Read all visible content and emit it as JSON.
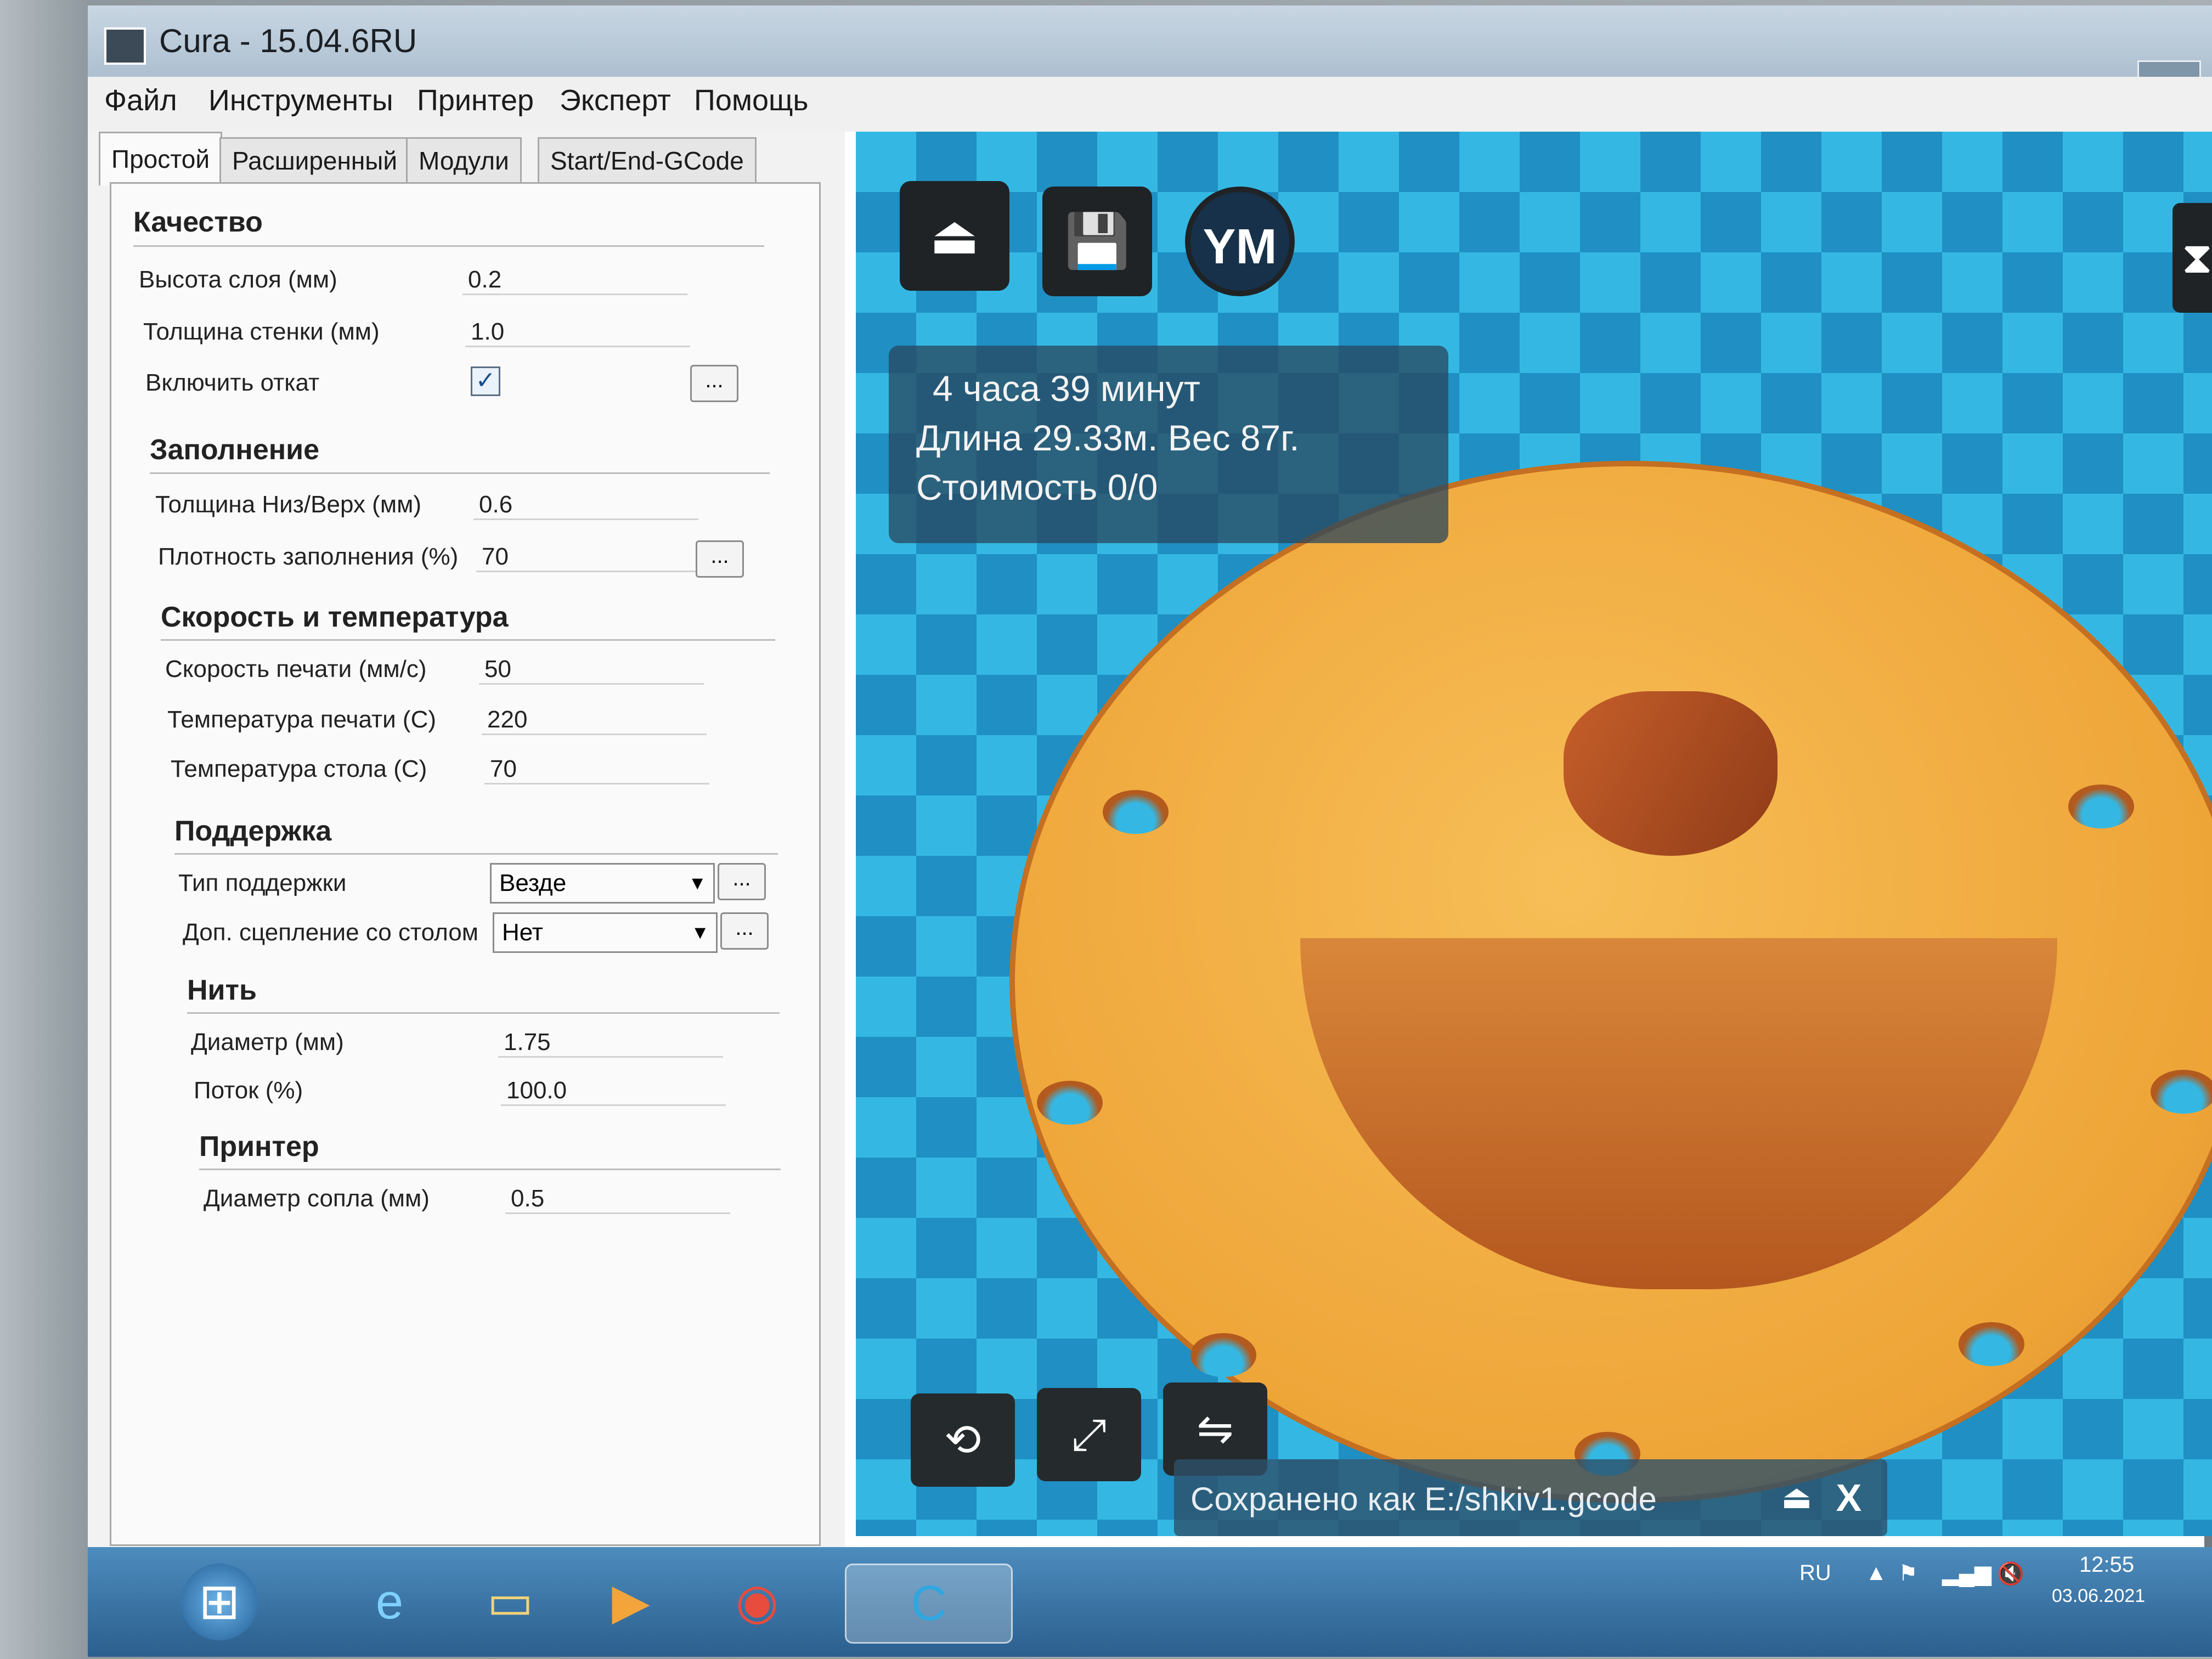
{
  "window": {
    "title": "Cura - 15.04.6RU"
  },
  "menu": [
    "Файл",
    "Инструменты",
    "Принтер",
    "Эксперт",
    "Помощь"
  ],
  "tabs": [
    {
      "label": "Простой",
      "active": true
    },
    {
      "label": "Расширенный"
    },
    {
      "label": "Модули"
    },
    {
      "label": "Start/End-GCode"
    }
  ],
  "settings": {
    "quality": {
      "title": "Качество",
      "layer_height_label": "Высота слоя (мм)",
      "layer_height": "0.2",
      "wall_thickness_label": "Толщина стенки (мм)",
      "wall_thickness": "1.0",
      "retraction_label": "Включить откат",
      "retraction_check": "✓",
      "more": "..."
    },
    "fill": {
      "title": "Заполнение",
      "bottom_top_label": "Толщина Низ/Верх (мм)",
      "bottom_top": "0.6",
      "density_label": "Плотность заполнения (%)",
      "density": "70",
      "more": "..."
    },
    "speed": {
      "title": "Скорость и температура",
      "print_speed_label": "Скорость печати (мм/с)",
      "print_speed": "50",
      "print_temp_label": "Температура печати (C)",
      "print_temp": "220",
      "bed_temp_label": "Температура стола (C)",
      "bed_temp": "70"
    },
    "support": {
      "title": "Поддержка",
      "type_label": "Тип поддержки",
      "type": "Везде",
      "adhesion_label": "Доп. сцепление со столом",
      "adhesion": "Нет",
      "more": "..."
    },
    "filament": {
      "title": "Нить",
      "diameter_label": "Диаметр (мм)",
      "diameter": "1.75",
      "flow_label": "Поток (%)",
      "flow": "100.0"
    },
    "printer": {
      "title": "Принтер",
      "nozzle_label": "Диаметр сопла (мм)",
      "nozzle": "0.5"
    }
  },
  "viewport": {
    "ym_label": "YM",
    "info": {
      "time": "4 часа 39 минут",
      "length_weight": "Длина 29.33м. Вес 87г.",
      "cost": "Стоимость 0/0"
    },
    "saved_message": "Сохранено как E:/shkiv1.gcode",
    "close_glyph": "X"
  },
  "taskbar": {
    "lang": "RU",
    "time": "12:55",
    "date": "03.06.2021"
  }
}
